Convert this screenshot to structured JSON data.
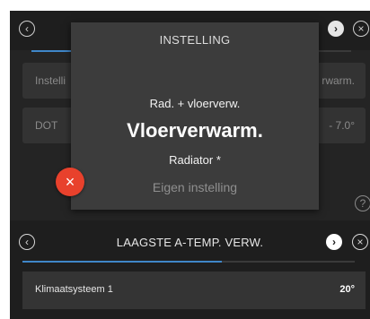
{
  "upper_screen": {
    "row1_label": "Instelli",
    "row1_value": "rwarm.",
    "row2_label": "DOT",
    "row2_value": "- 7.0°",
    "back_icon": "chevron-left-icon",
    "next_icon": "chevron-right-icon",
    "close_icon": "close-icon",
    "help_icon": "help-icon",
    "back_glyph": "‹",
    "next_glyph": "›",
    "close_glyph": "×",
    "help_glyph": "?",
    "progress_fraction": 0.16
  },
  "dialog": {
    "title": "INSTELLING",
    "options": [
      "Rad. + vloerverw.",
      "Vloerverwarm.",
      "Radiator *",
      "Eigen instelling"
    ],
    "selected_index": 1,
    "cancel_glyph": "×"
  },
  "lower_screen": {
    "title": "LAAGSTE A-TEMP. VERW.",
    "back_glyph": "‹",
    "next_glyph": "›",
    "close_glyph": "×",
    "progress_fraction": 0.6,
    "row_label": "Klimaatsysteem 1",
    "row_value": "20°"
  },
  "colors": {
    "accent_blue": "#3f86c8",
    "cancel_red": "#e8412c",
    "panel_dark": "#1e1e1e",
    "dialog_bg": "#3c3c3c"
  }
}
